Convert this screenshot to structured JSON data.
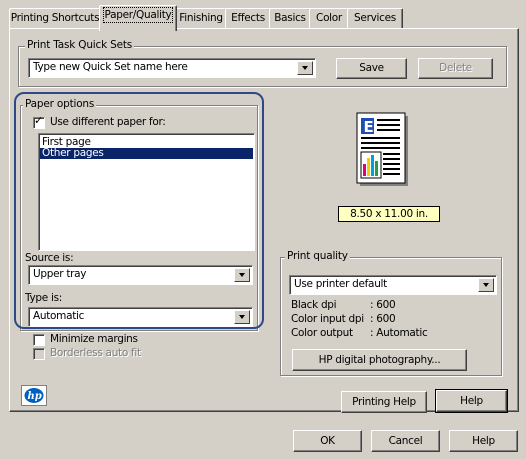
{
  "tabs": [
    {
      "label": "Printing Shortcuts"
    },
    {
      "label": "Paper/Quality"
    },
    {
      "label": "Finishing"
    },
    {
      "label": "Effects"
    },
    {
      "label": "Basics"
    },
    {
      "label": "Color"
    },
    {
      "label": "Services"
    }
  ],
  "quick_sets": {
    "group_label": "Print Task Quick Sets",
    "value": "Type new Quick Set name here",
    "save_label": "Save",
    "delete_label": "Delete"
  },
  "paper_options": {
    "group_label": "Paper options",
    "use_different_label": "Use different paper for:",
    "use_different_checked": true,
    "list_items": [
      {
        "label": "First page",
        "selected": false
      },
      {
        "label": "Other pages",
        "selected": true
      }
    ],
    "source_label": "Source is:",
    "source_value": "Upper tray",
    "type_label": "Type is:",
    "type_value": "Automatic",
    "minimize_margins_label": "Minimize margins",
    "borderless_label": "Borderless auto fit"
  },
  "preview": {
    "paper_size": "8.50 x 11.00 in.",
    "page_letter": "E"
  },
  "print_quality": {
    "group_label": "Print quality",
    "value": "Use printer default",
    "black_dpi_label": "Black dpi",
    "black_dpi_value": ": 600",
    "color_dpi_label": "Color input dpi",
    "color_dpi_value": ": 600",
    "color_output_label": "Color output",
    "color_output_value": ": Automatic",
    "hp_photo_button": "HP digital photography..."
  },
  "footer": {
    "printing_help_label": "Printing Help",
    "help_label": "Help"
  },
  "dialog_buttons": {
    "ok_label": "OK",
    "cancel_label": "Cancel",
    "help_label": "Help"
  },
  "colors": {
    "dialog_bg": "#d4d0c8",
    "selection": "#0a246a",
    "highlight_ring": "#2d4a86",
    "paper_size_badge": "#ffffc0"
  }
}
